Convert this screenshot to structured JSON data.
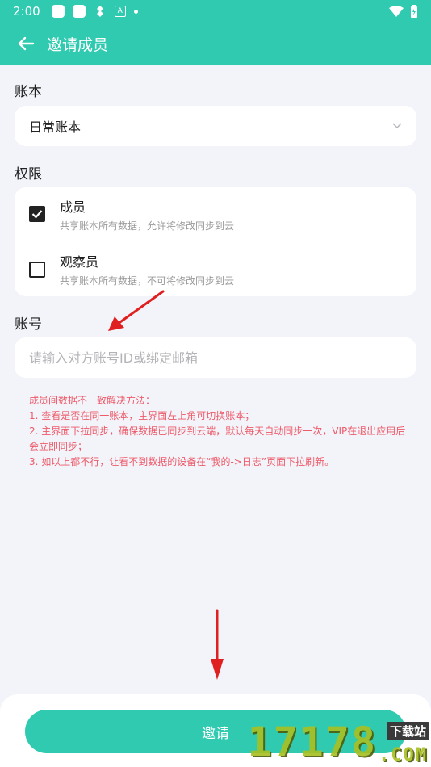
{
  "status_bar": {
    "time": "2:00",
    "a_label": "A"
  },
  "header": {
    "title": "邀请成员"
  },
  "book_section": {
    "label": "账本",
    "selected": "日常账本"
  },
  "permission_section": {
    "label": "权限",
    "options": [
      {
        "title": "成员",
        "desc": "共享账本所有数据，允许将修改同步到云",
        "checked": true
      },
      {
        "title": "观察员",
        "desc": "共享账本所有数据，不可将修改同步到云",
        "checked": false
      }
    ]
  },
  "account_section": {
    "label": "账号",
    "placeholder": "请输入对方账号ID或绑定邮箱",
    "value": ""
  },
  "help": {
    "lines": [
      "成员间数据不一致解决方法：",
      "1. 查看是否在同一账本，主界面左上角可切换账本；",
      "2. 主界面下拉同步，确保数据已同步到云端，默认每天自动同步一次，VIP在退出应用后会立即同步；",
      "3. 如以上都不行，让看不到数据的设备在“我的->日志”页面下拉刷新。"
    ]
  },
  "footer": {
    "invite_label": "邀请"
  },
  "watermark": {
    "text": "17178",
    "sub": "下载站",
    "suffix": ".COM"
  },
  "colors": {
    "accent": "#2fcab0",
    "help_text": "#ee5a6a",
    "arrow": "#e02020"
  }
}
